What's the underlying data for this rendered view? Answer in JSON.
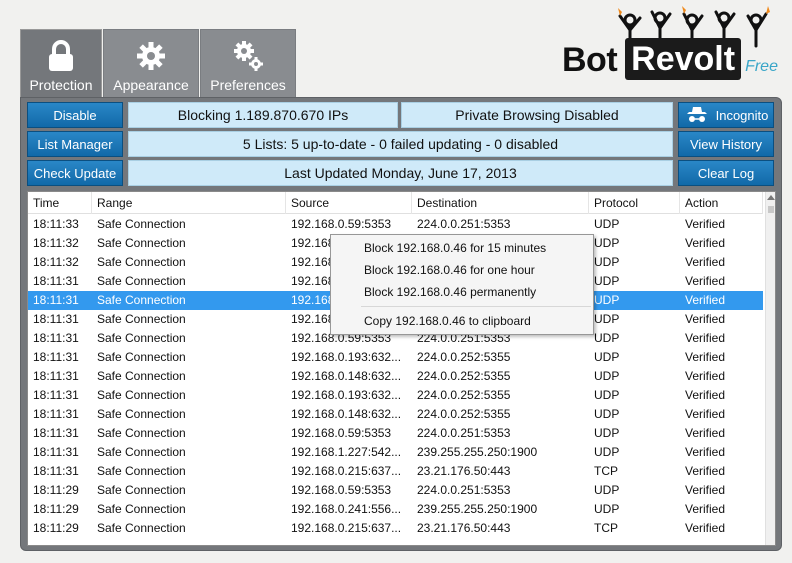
{
  "tabs": [
    {
      "label": "Protection",
      "icon": "lock-icon",
      "active": true
    },
    {
      "label": "Appearance",
      "icon": "gear-icon",
      "active": false
    },
    {
      "label": "Preferences",
      "icon": "gears-icon",
      "active": false
    }
  ],
  "logo": {
    "bot": "Bot",
    "revolt": "Revolt",
    "free": "Free"
  },
  "buttons": {
    "disable": "Disable",
    "list_manager": "List Manager",
    "check_update": "Check Update",
    "incognito": "Incognito",
    "view_history": "View History",
    "clear_log": "Clear Log"
  },
  "info": {
    "blocking": "Blocking 1.189.870.670 IPs",
    "private_browsing": "Private Browsing Disabled",
    "lists": "5 Lists: 5 up-to-date - 0 failed updating - 0 disabled",
    "last_updated": "Last Updated Monday, June 17, 2013"
  },
  "table": {
    "headers": {
      "time": "Time",
      "range": "Range",
      "source": "Source",
      "destination": "Destination",
      "protocol": "Protocol",
      "action": "Action"
    },
    "rows": [
      {
        "time": "18:11:33",
        "range": "Safe Connection",
        "source": "192.168.0.59:5353",
        "destination": "224.0.0.251:5353",
        "protocol": "UDP",
        "action": "Verified"
      },
      {
        "time": "18:11:32",
        "range": "Safe Connection",
        "source": "192.168",
        "destination": "",
        "protocol": "UDP",
        "action": "Verified"
      },
      {
        "time": "18:11:32",
        "range": "Safe Connection",
        "source": "192.168",
        "destination": "",
        "protocol": "UDP",
        "action": "Verified"
      },
      {
        "time": "18:11:31",
        "range": "Safe Connection",
        "source": "192.168",
        "destination": "",
        "protocol": "UDP",
        "action": "Verified"
      },
      {
        "time": "18:11:31",
        "range": "Safe Connection",
        "source": "192.168",
        "destination": "",
        "protocol": "UDP",
        "action": "Verified"
      },
      {
        "time": "18:11:31",
        "range": "Safe Connection",
        "source": "192.168",
        "destination": "",
        "protocol": "UDP",
        "action": "Verified"
      },
      {
        "time": "18:11:31",
        "range": "Safe Connection",
        "source": "192.168.0.59:5353",
        "destination": "224.0.0.251:5353",
        "protocol": "UDP",
        "action": "Verified"
      },
      {
        "time": "18:11:31",
        "range": "Safe Connection",
        "source": "192.168.0.193:632...",
        "destination": "224.0.0.252:5355",
        "protocol": "UDP",
        "action": "Verified"
      },
      {
        "time": "18:11:31",
        "range": "Safe Connection",
        "source": "192.168.0.148:632...",
        "destination": "224.0.0.252:5355",
        "protocol": "UDP",
        "action": "Verified"
      },
      {
        "time": "18:11:31",
        "range": "Safe Connection",
        "source": "192.168.0.193:632...",
        "destination": "224.0.0.252:5355",
        "protocol": "UDP",
        "action": "Verified"
      },
      {
        "time": "18:11:31",
        "range": "Safe Connection",
        "source": "192.168.0.148:632...",
        "destination": "224.0.0.252:5355",
        "protocol": "UDP",
        "action": "Verified"
      },
      {
        "time": "18:11:31",
        "range": "Safe Connection",
        "source": "192.168.0.59:5353",
        "destination": "224.0.0.251:5353",
        "protocol": "UDP",
        "action": "Verified"
      },
      {
        "time": "18:11:31",
        "range": "Safe Connection",
        "source": "192.168.1.227:542...",
        "destination": "239.255.255.250:1900",
        "protocol": "UDP",
        "action": "Verified"
      },
      {
        "time": "18:11:31",
        "range": "Safe Connection",
        "source": "192.168.0.215:637...",
        "destination": "23.21.176.50:443",
        "protocol": "TCP",
        "action": "Verified"
      },
      {
        "time": "18:11:29",
        "range": "Safe Connection",
        "source": "192.168.0.59:5353",
        "destination": "224.0.0.251:5353",
        "protocol": "UDP",
        "action": "Verified"
      },
      {
        "time": "18:11:29",
        "range": "Safe Connection",
        "source": "192.168.0.241:556...",
        "destination": "239.255.255.250:1900",
        "protocol": "UDP",
        "action": "Verified"
      },
      {
        "time": "18:11:29",
        "range": "Safe Connection",
        "source": "192.168.0.215:637...",
        "destination": "23.21.176.50:443",
        "protocol": "TCP",
        "action": "Verified"
      }
    ]
  },
  "context_menu": [
    "Block 192.168.0.46 for 15 minutes",
    "Block 192.168.0.46 for one hour",
    "Block 192.168.0.46 permanently",
    "Copy 192.168.0.46 to clipboard"
  ],
  "colors": {
    "accent_blue": "#1a78b9",
    "info_bg": "#cfeaf9",
    "panel_gray": "#74777b",
    "selected_row": "#3399ee"
  }
}
